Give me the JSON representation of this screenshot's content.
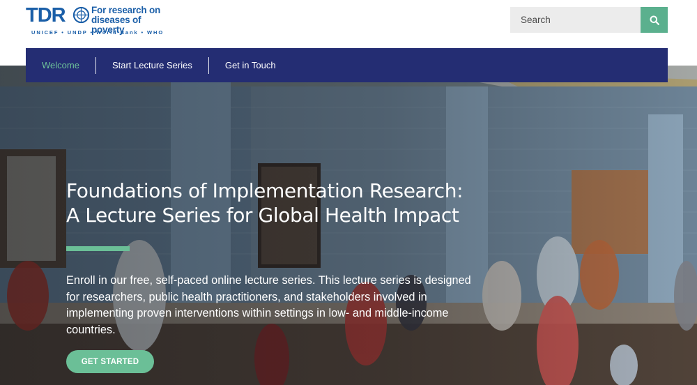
{
  "header": {
    "logo": {
      "mark": "TDR",
      "tagline_line1": "For research on",
      "tagline_line2": "diseases of poverty",
      "partners": "UNICEF • UNDP • World Bank • WHO"
    },
    "search": {
      "placeholder": "Search",
      "value": "",
      "button_icon": "search-icon"
    }
  },
  "nav": {
    "items": [
      {
        "label": "Welcome",
        "active": true
      },
      {
        "label": "Start Lecture Series",
        "active": false
      },
      {
        "label": "Get in Touch",
        "active": false
      }
    ]
  },
  "hero": {
    "title_line1": "Foundations of Implementation Research:",
    "title_line2": "A Lecture Series for Global Health Impact",
    "description": "Enroll in our free, self-paced online lecture series. This lecture series is designed for researchers, public health practitioners, and stakeholders involved in implementing proven interventions within settings in low- and middle-income countries.",
    "cta_label": "GET STARTED"
  },
  "colors": {
    "brand_blue": "#1b5fa8",
    "nav_background": "#242d73",
    "accent_green": "#6bbf97",
    "search_button": "#5bb08e",
    "search_field": "#ececec"
  }
}
